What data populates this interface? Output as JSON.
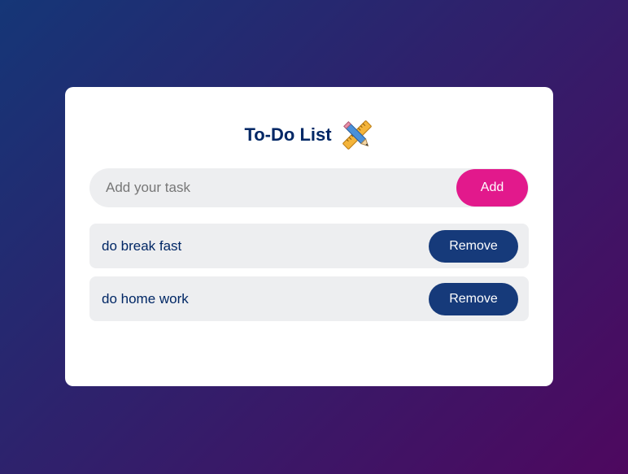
{
  "app": {
    "title": "To-Do List",
    "title_icon": "pencil-ruler-icon"
  },
  "input": {
    "placeholder": "Add your task",
    "value": "",
    "add_label": "Add"
  },
  "tasks": [
    {
      "text": "do break fast",
      "remove_label": "Remove"
    },
    {
      "text": "do home work",
      "remove_label": "Remove"
    }
  ],
  "colors": {
    "background_start": "#153677",
    "background_end": "#4e085f",
    "title": "#002765",
    "add_button": "#e2198c",
    "remove_button": "#163a7a",
    "row_background": "#edeef0"
  }
}
